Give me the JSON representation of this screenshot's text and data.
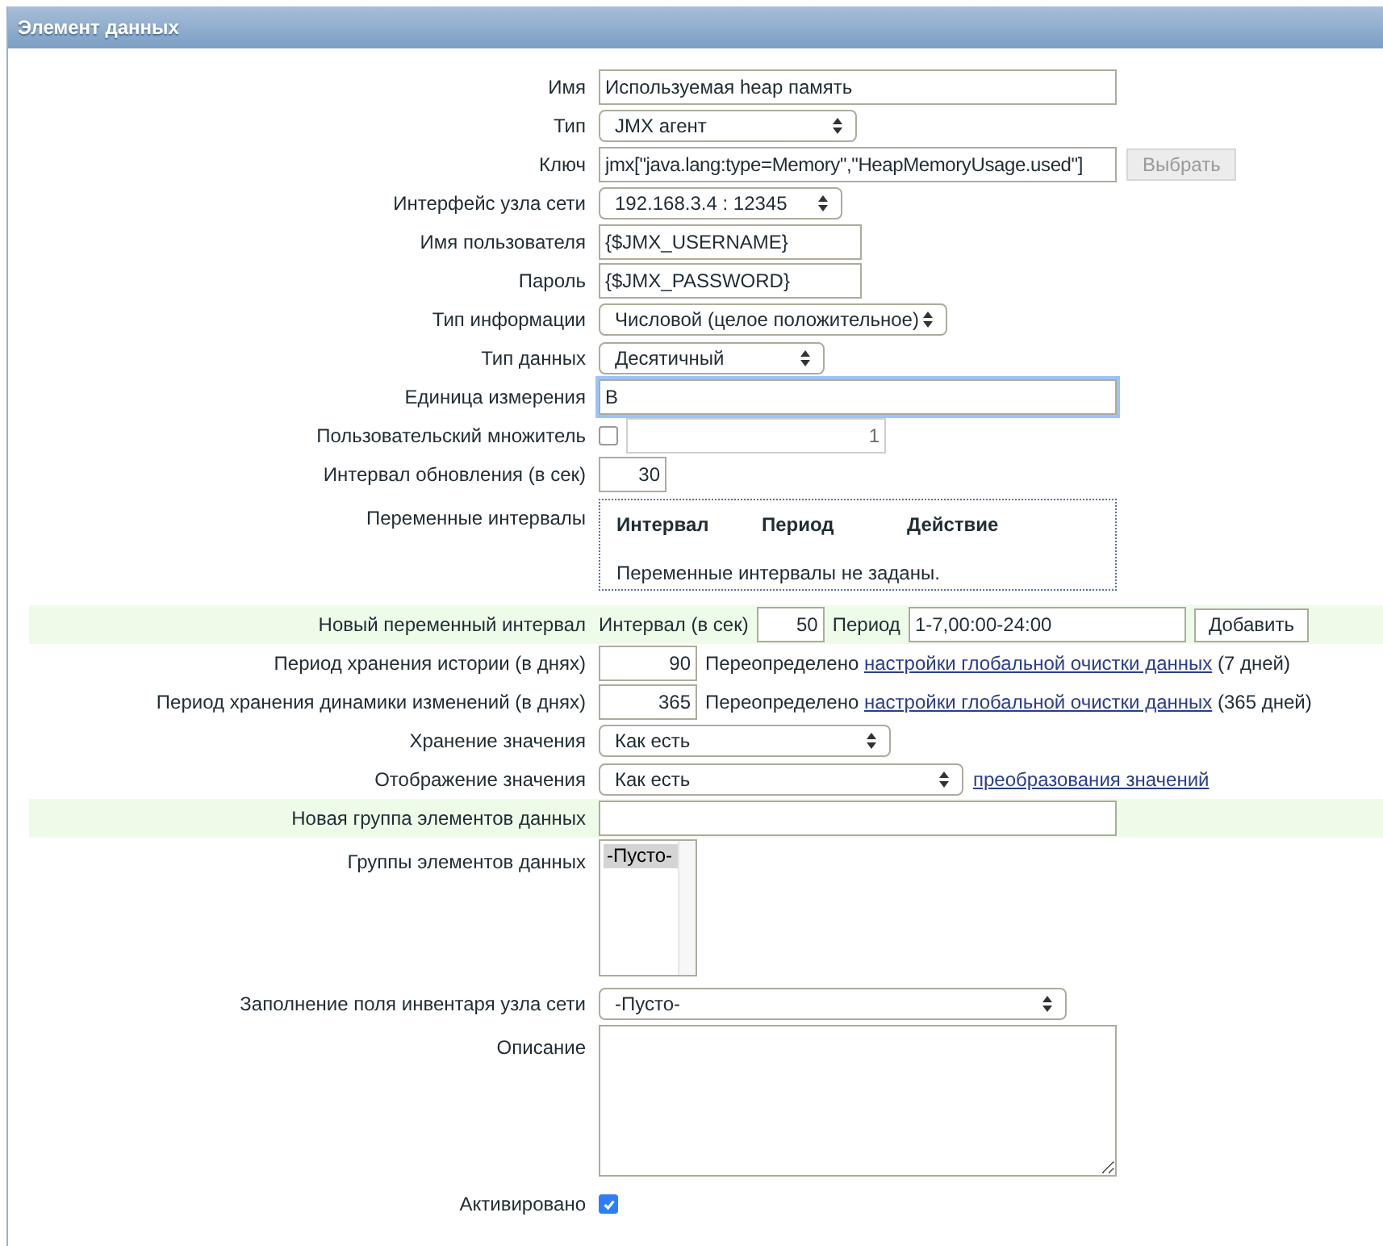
{
  "panel": {
    "title": "Элемент данных"
  },
  "fields": [
    {
      "kind": "text",
      "label": "Имя",
      "value": "Используемая heap память"
    },
    {
      "kind": "select",
      "label": "Тип",
      "value": "JMX агент"
    },
    {
      "kind": "key",
      "label": "Ключ",
      "value": "jmx[\"java.lang:type=Memory\",\"HeapMemoryUsage.used\"]",
      "button": {
        "label": "Выбрать",
        "disabled": true
      }
    },
    {
      "kind": "select",
      "label": "Интерфейс узла сети",
      "value": "192.168.3.4 : 12345"
    },
    {
      "kind": "text",
      "label": "Имя пользователя",
      "value": "{$JMX_USERNAME}"
    },
    {
      "kind": "text",
      "label": "Пароль",
      "value": "{$JMX_PASSWORD}"
    },
    {
      "kind": "select",
      "label": "Тип информации",
      "value": "Числовой (целое положительное)"
    },
    {
      "kind": "select",
      "label": "Тип данных",
      "value": "Десятичный"
    },
    {
      "kind": "text",
      "label": "Единица измерения",
      "value": "B",
      "focused": true
    },
    {
      "kind": "multiplier",
      "label": "Пользовательский множитель",
      "checked": false,
      "value": "1"
    },
    {
      "kind": "number",
      "label": "Интервал обновления (в сек)",
      "value": "30"
    },
    {
      "kind": "intervals",
      "label": "Переменные интервалы",
      "columns": [
        "Интервал",
        "Период",
        "Действие"
      ],
      "empty_text": "Переменные интервалы не заданы."
    },
    {
      "kind": "new_interval",
      "label": "Новый переменный интервал",
      "highlighted": true,
      "interval_label": "Интервал (в сек)",
      "interval_value": "50",
      "period_label": "Период",
      "period_value": "1-7,00:00-24:00",
      "button": "Добавить"
    },
    {
      "kind": "retention",
      "label": "Период хранения истории (в днях)",
      "value": "90",
      "prefix": "Переопределено",
      "link": "настройки глобальной очистки данных",
      "suffix": "(7 дней)"
    },
    {
      "kind": "retention",
      "label": "Период хранения динамики изменений (в днях)",
      "value": "365",
      "prefix": "Переопределено",
      "link": "настройки глобальной очистки данных",
      "suffix": "(365 дней)"
    },
    {
      "kind": "select",
      "label": "Хранение значения",
      "value": "Как есть"
    },
    {
      "kind": "select",
      "label": "Отображение значения",
      "value": "Как есть",
      "link": "преобразования значений"
    },
    {
      "kind": "text",
      "label": "Новая группа элементов данных",
      "highlighted": true
    },
    {
      "kind": "listbox",
      "label": "Группы элементов данных",
      "items": [
        {
          "label": "-Пусто-",
          "selected": true
        }
      ]
    },
    {
      "kind": "select",
      "label": "Заполнение поля инвентаря узла сети",
      "value": "-Пусто-"
    },
    {
      "kind": "textarea",
      "label": "Описание"
    },
    {
      "kind": "checkbox",
      "label": "Активировано",
      "checked": true
    }
  ]
}
